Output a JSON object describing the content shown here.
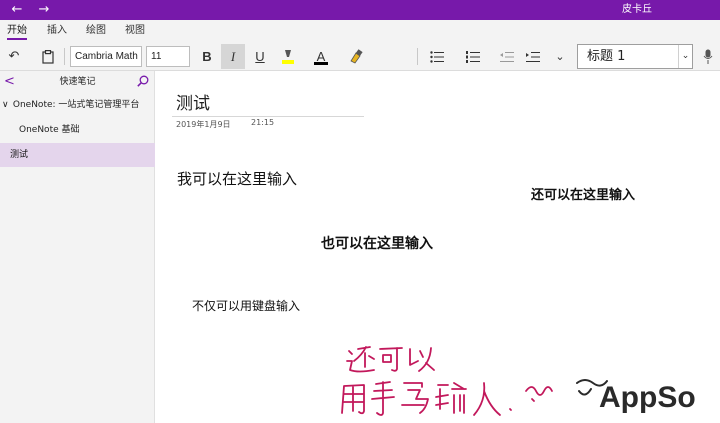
{
  "app": {
    "user_name": "皮卡丘",
    "accent_color": "#7719aa",
    "selection_color": "#e4d5ec"
  },
  "titlebar": {
    "back_icon": "←",
    "forward_icon": "→"
  },
  "ribbon": {
    "tabs": [
      {
        "label": "开始",
        "active": true
      },
      {
        "label": "插入"
      },
      {
        "label": "绘图"
      },
      {
        "label": "视图"
      }
    ]
  },
  "toolbar": {
    "undo_icon": "↶",
    "clipboard_icon": "clipboard",
    "font_name": "Cambria Math",
    "font_size": "11",
    "bold_label": "B",
    "italic_label": "I",
    "underline_label": "U",
    "font_color_label": "A",
    "highlight_color": "#ffff00",
    "font_color": "#000000",
    "style_value": "标题 1",
    "style_dropdown_icon": "⌄",
    "more_icon": "⌄"
  },
  "sidebar": {
    "back_icon": "<",
    "title": "快速笔记",
    "notebook": "OneNote: 一站式笔记管理平台",
    "notebook_chevron": "∨",
    "section": "OneNote 基础",
    "page": "测试"
  },
  "page": {
    "title": "测试",
    "date": "2019年1月9日",
    "time": "21:15",
    "notes": [
      "我可以在这里输入",
      "还可以在这里输入",
      "也可以在这里输入",
      "不仅可以用键盘输入"
    ],
    "ink_color": "#c2185b"
  },
  "watermark": {
    "logo_text": "AppSo"
  }
}
